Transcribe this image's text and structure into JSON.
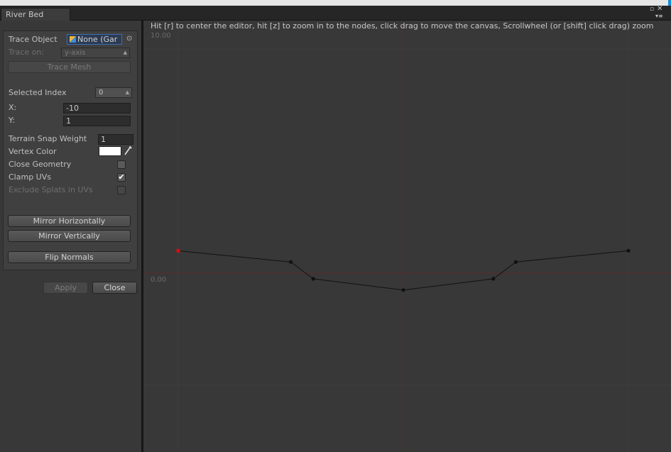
{
  "window": {
    "tab_title": "River Bed",
    "buttons": {
      "maximize": "▫",
      "close": "✕",
      "menu": "▾≡"
    },
    "accent_color": "#1a8ad6"
  },
  "inspector": {
    "trace_object": {
      "label": "Trace Object",
      "value": "None (Gar"
    },
    "trace_on": {
      "label": "Trace on:",
      "value": "y-axis"
    },
    "trace_mesh_button": "Trace Mesh",
    "selected_index": {
      "label": "Selected Index",
      "value": "0"
    },
    "x": {
      "label": "X:",
      "value": "-10"
    },
    "y": {
      "label": "Y:",
      "value": "1"
    },
    "terrain_snap_weight": {
      "label": "Terrain Snap Weight",
      "value": "1"
    },
    "vertex_color": {
      "label": "Vertex Color",
      "value": "#ffffff"
    },
    "close_geometry": {
      "label": "Close Geometry",
      "checked": false
    },
    "clamp_uvs": {
      "label": "Clamp UVs",
      "checked": true,
      "mark": "✔"
    },
    "exclude_splats": {
      "label": "Exclude Splats in UVs",
      "checked": false
    },
    "mirror_horizontally_button": "Mirror Horizontally",
    "mirror_vertically_button": "Mirror Vertically",
    "flip_normals_button": "Flip Normals"
  },
  "actions": {
    "apply_label": "Apply",
    "close_label": "Close"
  },
  "editor": {
    "hint": "Hit [r] to center the editor, hit [z] to zoom in to the nodes, click drag to move the canvas, Scrollwheel (or [shift] click drag) zoom",
    "y_label_top": "10.00",
    "y_label_origin": "0.00",
    "colors": {
      "background": "#383838",
      "grid": "#3e3e3e",
      "axis": "#5a2a2a",
      "line": "#111111",
      "node": "#111111",
      "selected_node": "#d01010"
    },
    "path_points": [
      {
        "x": -10,
        "y": 1.0,
        "selected": true
      },
      {
        "x": -5,
        "y": 0.5
      },
      {
        "x": -4,
        "y": -0.25
      },
      {
        "x": 0,
        "y": -0.75
      },
      {
        "x": 4,
        "y": -0.25
      },
      {
        "x": 5,
        "y": 0.5
      },
      {
        "x": 10,
        "y": 1.0
      }
    ]
  }
}
